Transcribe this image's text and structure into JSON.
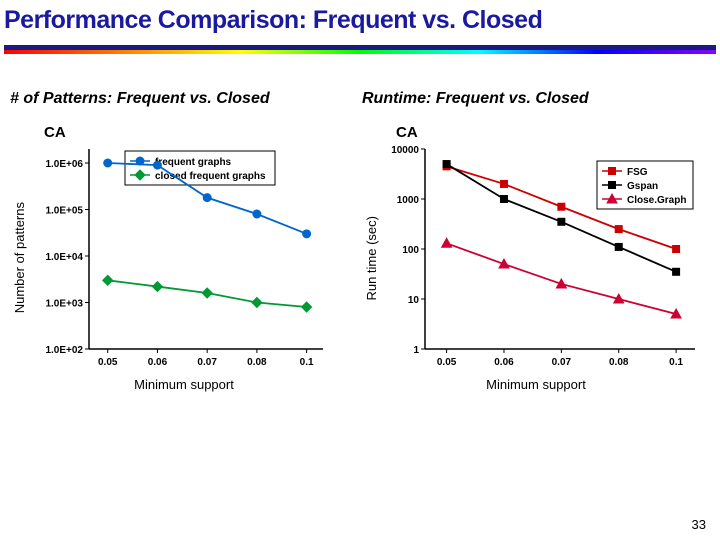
{
  "slide_title": "Performance Comparison: Frequent vs. Closed",
  "page_number": "33",
  "left": {
    "section_title": "# of Patterns: Frequent vs. Closed",
    "dataset": "CA",
    "xlabel": "Minimum support",
    "ylabel": "Number of patterns"
  },
  "right": {
    "section_title": "Runtime: Frequent vs. Closed",
    "dataset": "CA",
    "xlabel": "Minimum support",
    "ylabel": "Run time (sec)"
  },
  "chart_data": [
    {
      "type": "line",
      "id": "left",
      "x": [
        0.05,
        0.06,
        0.07,
        0.08,
        0.1
      ],
      "x_tick_labels": [
        "0.05",
        "0.06",
        "0.07",
        "0.08",
        "0.1"
      ],
      "y_tick_labels": [
        "1.0E+02",
        "1.0E+03",
        "1.0E+04",
        "1.0E+05",
        "1.0E+06"
      ],
      "yscale": "log",
      "ylim": [
        100,
        2000000
      ],
      "series": [
        {
          "name": "frequent graphs",
          "color": "#0066cc",
          "marker": "circle",
          "values": [
            1000000,
            900000,
            180000,
            80000,
            30000
          ]
        },
        {
          "name": "closed frequent graphs",
          "color": "#009933",
          "marker": "diamond",
          "values": [
            3000,
            2200,
            1600,
            1000,
            800
          ]
        }
      ]
    },
    {
      "type": "line",
      "id": "right",
      "x": [
        0.05,
        0.06,
        0.07,
        0.08,
        0.1
      ],
      "x_tick_labels": [
        "0.05",
        "0.06",
        "0.07",
        "0.08",
        "0.1"
      ],
      "y_tick_labels": [
        "1",
        "10",
        "100",
        "1000",
        "10000"
      ],
      "yscale": "log",
      "ylim": [
        1,
        10000
      ],
      "series": [
        {
          "name": "FSG",
          "color": "#cc0000",
          "marker": "square",
          "values": [
            4500,
            2000,
            700,
            250,
            100
          ]
        },
        {
          "name": "Gspan",
          "color": "#000000",
          "marker": "square",
          "values": [
            5000,
            1000,
            350,
            110,
            35
          ]
        },
        {
          "name": "Close.Graph",
          "color": "#cc0033",
          "marker": "triangle",
          "values": [
            130,
            50,
            20,
            10,
            5
          ]
        }
      ]
    }
  ]
}
